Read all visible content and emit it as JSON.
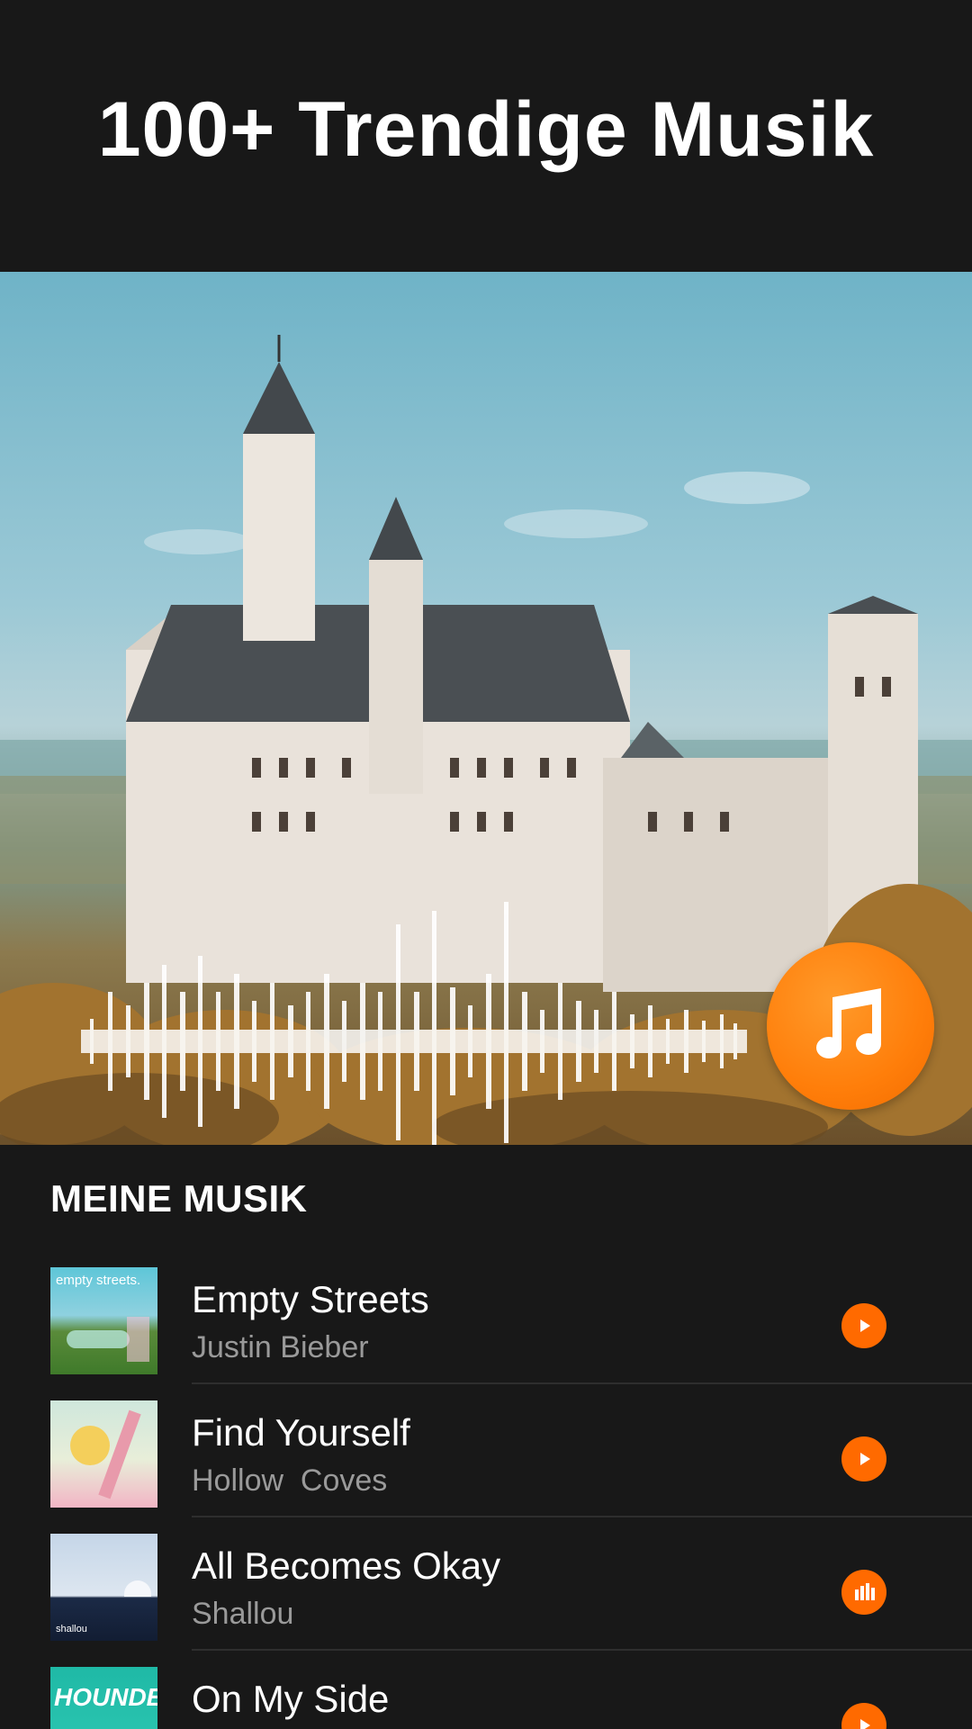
{
  "header": {
    "title": "100+ Trendige Musik"
  },
  "hero": {
    "image_subject": "castle",
    "accent_color": "#ff7e0a"
  },
  "section": {
    "title": "MEINE MUSIK"
  },
  "tracks": [
    {
      "title": "Empty Streets",
      "artist": "Justin Bieber",
      "cover_text": "empty streets.",
      "state": "play"
    },
    {
      "title": "Find Yourself",
      "artist": "Hollow  Coves",
      "state": "play"
    },
    {
      "title": "All Becomes Okay",
      "artist": "Shallou",
      "cover_text": "shallou",
      "state": "playing"
    },
    {
      "title": "On My Side",
      "artist": "",
      "cover_text": "HOUNDED",
      "state": "play"
    }
  ],
  "icons": {
    "fab": "music-note-icon",
    "play": "play-icon",
    "playing": "equalizer-icon"
  }
}
